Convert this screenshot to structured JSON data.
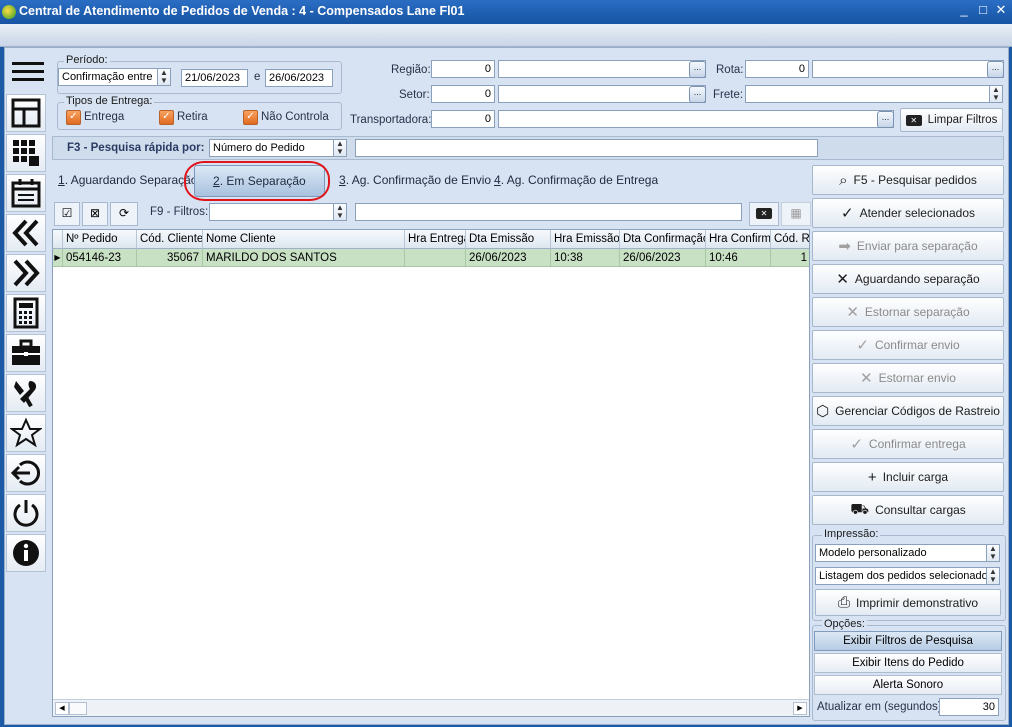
{
  "window": {
    "title": "Central de Atendimento de Pedidos de Venda : 4 - Compensados Lane Fl01",
    "minimize": "_",
    "maximize": "□",
    "close": "✕"
  },
  "periodo": {
    "label": "Período:",
    "type_value": "Confirmação entre",
    "date_from": "21/06/2023",
    "conj": "e",
    "date_to": "26/06/2023"
  },
  "tipos": {
    "label": "Tipos de Entrega:",
    "items": [
      "Entrega",
      "Retira",
      "Não Controla"
    ]
  },
  "filters": {
    "regiao_label": "Região:",
    "regiao_code": "0",
    "setor_label": "Setor:",
    "setor_code": "0",
    "transp_label": "Transportadora:",
    "transp_code": "0",
    "rota_label": "Rota:",
    "rota_code": "0",
    "frete_label": "Frete:",
    "clear_label": "Limpar Filtros"
  },
  "quick_search": {
    "label": "F3 - Pesquisa rápida por:",
    "field": "Número do Pedido",
    "value": ""
  },
  "tabs": [
    {
      "num": "1",
      "label": ". Aguardando Separação"
    },
    {
      "num": "2",
      "label": ". Em Separação"
    },
    {
      "num": "3",
      "label": ". Ag. Confirmação de Envio"
    },
    {
      "num": "4",
      "label": ". Ag. Confirmação de Entrega"
    }
  ],
  "f9": {
    "label": "F9 - Filtros:"
  },
  "grid": {
    "headers": [
      "Nº Pedido",
      "Cód. Cliente",
      "Nome Cliente",
      "Hra Entrega",
      "Dta Emissão",
      "Hra Emissão",
      "Dta Confirmação",
      "Hra Confirmação",
      "Cód. Re"
    ],
    "rows": [
      [
        "054146-23",
        "35067",
        "MARILDO DOS SANTOS",
        "",
        "26/06/2023",
        "10:38",
        "26/06/2023",
        "10:46",
        "1"
      ]
    ]
  },
  "actions": [
    {
      "label": "F5 - Pesquisar pedidos",
      "icon": "search-icon",
      "enabled": true
    },
    {
      "label": "Atender selecionados",
      "icon": "check-icon",
      "enabled": true
    },
    {
      "label": "Enviar para separação",
      "icon": "arrow-right-icon",
      "enabled": false
    },
    {
      "label": "Aguardando separação",
      "icon": "x-icon",
      "enabled": true
    },
    {
      "label": "Estornar separação",
      "icon": "x-icon",
      "enabled": false
    },
    {
      "label": "Confirmar envio",
      "icon": "check-icon",
      "enabled": false
    },
    {
      "label": "Estornar envio",
      "icon": "x-icon",
      "enabled": false
    },
    {
      "label": "Gerenciar Códigos de Rastreio",
      "icon": "box-icon",
      "enabled": true
    },
    {
      "label": "Confirmar entrega",
      "icon": "check-icon",
      "enabled": false
    },
    {
      "label": "Incluir carga",
      "icon": "plus-icon",
      "enabled": true
    },
    {
      "label": "Consultar cargas",
      "icon": "truck-icon",
      "enabled": true
    }
  ],
  "impressao": {
    "label": "Impressão:",
    "model": "Modelo personalizado",
    "listing": "Listagem dos pedidos selecionados",
    "print": "Imprimir demonstrativo"
  },
  "opcoes": {
    "label": "Opções:",
    "items": [
      "Exibir Filtros de Pesquisa",
      "Exibir Itens do Pedido",
      "Alerta Sonoro"
    ],
    "refresh_label": "Atualizar em (segundos):",
    "refresh_value": "30"
  },
  "sidebar_icons": [
    "menu-icon",
    "layout-icon",
    "grid-apps-icon",
    "calendar-icon",
    "double-left-icon",
    "double-right-icon",
    "calculator-icon",
    "briefcase-icon",
    "tools-icon",
    "star-icon",
    "logout-icon",
    "power-icon",
    "info-icon"
  ]
}
